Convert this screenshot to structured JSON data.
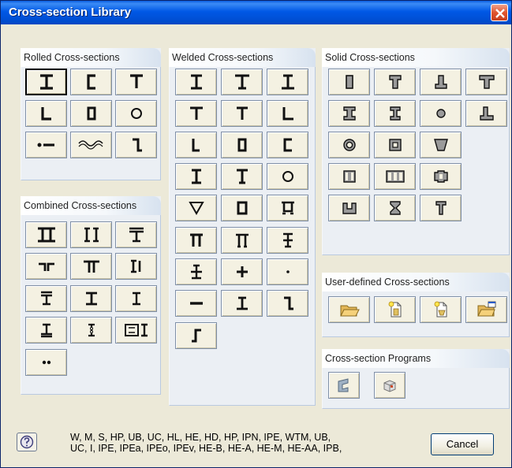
{
  "window": {
    "title": "Cross-section Library"
  },
  "groups": {
    "rolled": "Rolled Cross-sections",
    "welded": "Welded Cross-sections",
    "solid": "Solid Cross-sections",
    "combined": "Combined Cross-sections",
    "user_defined": "User-defined Cross-sections",
    "programs": "Cross-section Programs"
  },
  "footer": {
    "description_line1": "W, M, S, HP, UB, UC, HL, HE, HD, HP, IPN, IPE, WTM, UB,",
    "description_line2": "UC, I, IPE, IPEa, IPEo, IPEv, HE-B, HE-A, HE-M, HE-AA, IPB,",
    "cancel_label": "Cancel"
  },
  "colors": {
    "title_bar": "#0054e3",
    "panel_bg": "#ebeff4",
    "tile_bg": "#f4f1e2",
    "tile_border": "#7f8fa6"
  },
  "icons": {
    "rolled": [
      "i-beam-icon",
      "channel-icon",
      "tee-icon",
      "angle-icon",
      "rect-hollow-icon",
      "circular-hollow-icon",
      "flat-bar-icon",
      "corrugated-icon",
      "z-section-icon"
    ],
    "combined": [
      "double-i-icon",
      "back-to-back-i-icon",
      "t-on-i-icon",
      "double-angle-icon",
      "double-tee-icon",
      "i-with-plate-icon",
      "i-plate-top-icon",
      "i-plates-icon",
      "i-beam-small-icon",
      "i-plate-bottom-icon",
      "castellated-icon",
      "i-frame-icon",
      "dual-bars-icon"
    ],
    "welded": [
      "welded-i-icon",
      "welded-asym-i-icon",
      "welded-i-wide-icon",
      "welded-tee-icon",
      "welded-tee-2-icon",
      "welded-angle-icon",
      "welded-angle-2-icon",
      "welded-box-icon",
      "welded-channel-icon",
      "welded-i-tall-icon",
      "welded-t-box-icon",
      "welded-circle-icon",
      "welded-triangle-icon",
      "welded-rect-icon",
      "welded-box-flanged-icon",
      "welded-pi-icon",
      "welded-pi-2-icon",
      "welded-cross-i-icon",
      "welded-i-plate-icon",
      "welded-cross-icon",
      "welded-point-icon",
      "welded-flat-icon",
      "welded-t-plate-icon",
      "welded-z-icon",
      "welded-s-icon"
    ],
    "solid": [
      "solid-rect-icon",
      "solid-tee-icon",
      "solid-inverted-tee-icon",
      "solid-tee-wide-icon",
      "solid-i-icon",
      "solid-i-narrow-icon",
      "solid-circle-icon",
      "solid-l-icon",
      "solid-ring-icon",
      "solid-box-icon",
      "solid-trapezoid-icon",
      "solid-two-cells-icon",
      "solid-three-cells-icon",
      "solid-pier-icon",
      "solid-u-icon",
      "solid-hourglass-icon",
      "solid-column-icon"
    ],
    "user_defined": [
      "folder-open-icon",
      "new-document-icon",
      "edit-document-icon",
      "folder-window-icon"
    ],
    "programs": [
      "shape-program-icon",
      "cube-program-icon"
    ]
  }
}
